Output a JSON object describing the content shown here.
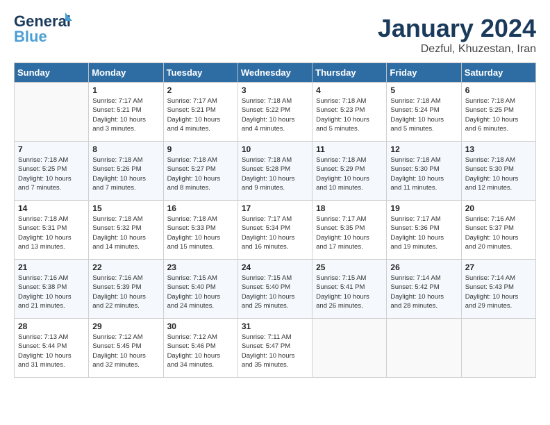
{
  "header": {
    "logo_line1": "General",
    "logo_line2": "Blue",
    "title": "January 2024",
    "subtitle": "Dezful, Khuzestan, Iran"
  },
  "weekdays": [
    "Sunday",
    "Monday",
    "Tuesday",
    "Wednesday",
    "Thursday",
    "Friday",
    "Saturday"
  ],
  "weeks": [
    [
      {
        "day": "",
        "info": ""
      },
      {
        "day": "1",
        "info": "Sunrise: 7:17 AM\nSunset: 5:21 PM\nDaylight: 10 hours\nand 3 minutes."
      },
      {
        "day": "2",
        "info": "Sunrise: 7:17 AM\nSunset: 5:21 PM\nDaylight: 10 hours\nand 4 minutes."
      },
      {
        "day": "3",
        "info": "Sunrise: 7:18 AM\nSunset: 5:22 PM\nDaylight: 10 hours\nand 4 minutes."
      },
      {
        "day": "4",
        "info": "Sunrise: 7:18 AM\nSunset: 5:23 PM\nDaylight: 10 hours\nand 5 minutes."
      },
      {
        "day": "5",
        "info": "Sunrise: 7:18 AM\nSunset: 5:24 PM\nDaylight: 10 hours\nand 5 minutes."
      },
      {
        "day": "6",
        "info": "Sunrise: 7:18 AM\nSunset: 5:25 PM\nDaylight: 10 hours\nand 6 minutes."
      }
    ],
    [
      {
        "day": "7",
        "info": "Sunrise: 7:18 AM\nSunset: 5:25 PM\nDaylight: 10 hours\nand 7 minutes."
      },
      {
        "day": "8",
        "info": "Sunrise: 7:18 AM\nSunset: 5:26 PM\nDaylight: 10 hours\nand 7 minutes."
      },
      {
        "day": "9",
        "info": "Sunrise: 7:18 AM\nSunset: 5:27 PM\nDaylight: 10 hours\nand 8 minutes."
      },
      {
        "day": "10",
        "info": "Sunrise: 7:18 AM\nSunset: 5:28 PM\nDaylight: 10 hours\nand 9 minutes."
      },
      {
        "day": "11",
        "info": "Sunrise: 7:18 AM\nSunset: 5:29 PM\nDaylight: 10 hours\nand 10 minutes."
      },
      {
        "day": "12",
        "info": "Sunrise: 7:18 AM\nSunset: 5:30 PM\nDaylight: 10 hours\nand 11 minutes."
      },
      {
        "day": "13",
        "info": "Sunrise: 7:18 AM\nSunset: 5:30 PM\nDaylight: 10 hours\nand 12 minutes."
      }
    ],
    [
      {
        "day": "14",
        "info": "Sunrise: 7:18 AM\nSunset: 5:31 PM\nDaylight: 10 hours\nand 13 minutes."
      },
      {
        "day": "15",
        "info": "Sunrise: 7:18 AM\nSunset: 5:32 PM\nDaylight: 10 hours\nand 14 minutes."
      },
      {
        "day": "16",
        "info": "Sunrise: 7:18 AM\nSunset: 5:33 PM\nDaylight: 10 hours\nand 15 minutes."
      },
      {
        "day": "17",
        "info": "Sunrise: 7:17 AM\nSunset: 5:34 PM\nDaylight: 10 hours\nand 16 minutes."
      },
      {
        "day": "18",
        "info": "Sunrise: 7:17 AM\nSunset: 5:35 PM\nDaylight: 10 hours\nand 17 minutes."
      },
      {
        "day": "19",
        "info": "Sunrise: 7:17 AM\nSunset: 5:36 PM\nDaylight: 10 hours\nand 19 minutes."
      },
      {
        "day": "20",
        "info": "Sunrise: 7:16 AM\nSunset: 5:37 PM\nDaylight: 10 hours\nand 20 minutes."
      }
    ],
    [
      {
        "day": "21",
        "info": "Sunrise: 7:16 AM\nSunset: 5:38 PM\nDaylight: 10 hours\nand 21 minutes."
      },
      {
        "day": "22",
        "info": "Sunrise: 7:16 AM\nSunset: 5:39 PM\nDaylight: 10 hours\nand 22 minutes."
      },
      {
        "day": "23",
        "info": "Sunrise: 7:15 AM\nSunset: 5:40 PM\nDaylight: 10 hours\nand 24 minutes."
      },
      {
        "day": "24",
        "info": "Sunrise: 7:15 AM\nSunset: 5:40 PM\nDaylight: 10 hours\nand 25 minutes."
      },
      {
        "day": "25",
        "info": "Sunrise: 7:15 AM\nSunset: 5:41 PM\nDaylight: 10 hours\nand 26 minutes."
      },
      {
        "day": "26",
        "info": "Sunrise: 7:14 AM\nSunset: 5:42 PM\nDaylight: 10 hours\nand 28 minutes."
      },
      {
        "day": "27",
        "info": "Sunrise: 7:14 AM\nSunset: 5:43 PM\nDaylight: 10 hours\nand 29 minutes."
      }
    ],
    [
      {
        "day": "28",
        "info": "Sunrise: 7:13 AM\nSunset: 5:44 PM\nDaylight: 10 hours\nand 31 minutes."
      },
      {
        "day": "29",
        "info": "Sunrise: 7:12 AM\nSunset: 5:45 PM\nDaylight: 10 hours\nand 32 minutes."
      },
      {
        "day": "30",
        "info": "Sunrise: 7:12 AM\nSunset: 5:46 PM\nDaylight: 10 hours\nand 34 minutes."
      },
      {
        "day": "31",
        "info": "Sunrise: 7:11 AM\nSunset: 5:47 PM\nDaylight: 10 hours\nand 35 minutes."
      },
      {
        "day": "",
        "info": ""
      },
      {
        "day": "",
        "info": ""
      },
      {
        "day": "",
        "info": ""
      }
    ]
  ]
}
